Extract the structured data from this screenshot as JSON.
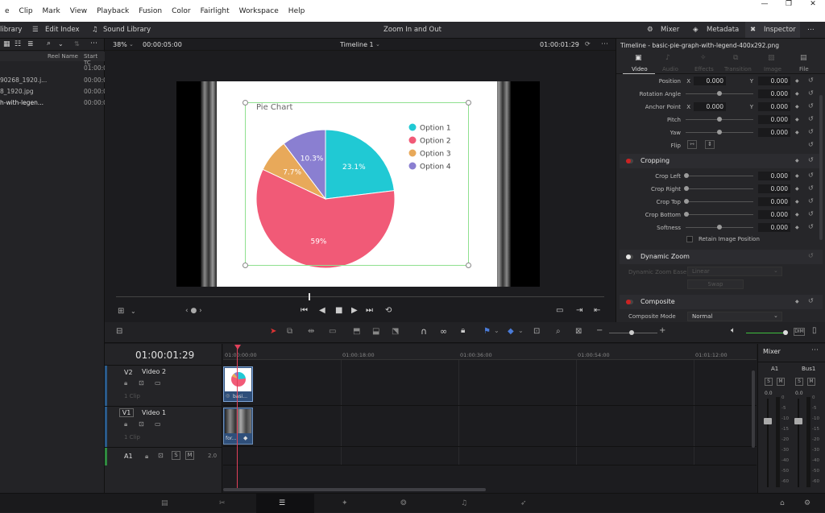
{
  "menu": [
    "e",
    "Clip",
    "Mark",
    "View",
    "Playback",
    "Fusion",
    "Color",
    "Fairlight",
    "Workspace",
    "Help"
  ],
  "toolbar": {
    "library": "library",
    "edit_index": "Edit Index",
    "sound_library": "Sound Library",
    "title": "Zoom In and Out",
    "mixer": "Mixer",
    "metadata": "Metadata",
    "inspector": "Inspector"
  },
  "mediapool": {
    "col_reel": "Reel Name",
    "col_start": "Start TC",
    "rows": [
      {
        "name": "",
        "tc": "01:00:0"
      },
      {
        "name": "90268_1920.j...",
        "tc": "00:00:0"
      },
      {
        "name": "8_1920.jpg",
        "tc": "00:00:0"
      },
      {
        "name": "h-with-legen...",
        "tc": "00:00:0"
      }
    ]
  },
  "viewer": {
    "zoom": "38%",
    "source_tc": "00:00:05:00",
    "timeline_name": "Timeline 1",
    "record_tc": "01:00:01:29"
  },
  "chart_data": {
    "type": "pie",
    "title": "Pie Chart",
    "legend_position": "top-right",
    "series": [
      {
        "name": "Option 1",
        "value": 23.1,
        "label": "23.1%",
        "color": "#20c9d4"
      },
      {
        "name": "Option 2",
        "value": 59,
        "label": "59%",
        "color": "#f15a77"
      },
      {
        "name": "Option 3",
        "value": 7.7,
        "label": "7.7%",
        "color": "#e8a95a"
      },
      {
        "name": "Option 4",
        "value": 10.3,
        "label": "10.3%",
        "color": "#8a7fd1"
      }
    ]
  },
  "inspector": {
    "header": "Timeline - basic-pie-graph-with-legend-400x292.png",
    "tabs": [
      "Video",
      "Audio",
      "Effects",
      "Transition",
      "Image",
      "File"
    ],
    "transform": [
      {
        "label": "Position",
        "x": "0.000",
        "y": "0.000"
      },
      {
        "label": "Rotation Angle",
        "v": "0.000"
      },
      {
        "label": "Anchor Point",
        "x": "0.000",
        "y": "0.000"
      },
      {
        "label": "Pitch",
        "v": "0.000"
      },
      {
        "label": "Yaw",
        "v": "0.000"
      },
      {
        "label": "Flip"
      }
    ],
    "cropping_title": "Cropping",
    "cropping": [
      {
        "label": "Crop Left",
        "v": "0.000"
      },
      {
        "label": "Crop Right",
        "v": "0.000"
      },
      {
        "label": "Crop Top",
        "v": "0.000"
      },
      {
        "label": "Crop Bottom",
        "v": "0.000"
      },
      {
        "label": "Softness",
        "v": "0.000"
      }
    ],
    "retain": "Retain Image Position",
    "dynamic_zoom": "Dynamic Zoom",
    "dz_ease_label": "Dynamic Zoom Ease",
    "dz_ease_value": "Linear",
    "dz_swap": "Swap",
    "composite": "Composite",
    "composite_mode_label": "Composite Mode",
    "composite_mode_value": "Normal"
  },
  "timeline": {
    "timecode": "01:00:01:29",
    "ruler": [
      "01:00:00:00",
      "01:00:18:00",
      "01:00:36:00",
      "01:00:54:00",
      "01:01:12:00"
    ],
    "tracks": [
      {
        "id": "V2",
        "name": "Video 2",
        "clips": "1 Clip",
        "clip_label": "basi..."
      },
      {
        "id": "V1",
        "name": "Video 1",
        "clips": "1 Clip",
        "clip_label": "for..."
      }
    ],
    "audio": {
      "id": "A1",
      "level": "2.0"
    },
    "mixer_title": "Mixer",
    "mixer_ch": [
      "A1",
      "Bus1"
    ],
    "mixer_val": [
      "0.0",
      "0.0"
    ],
    "db_scale": [
      "0",
      "-5",
      "-10",
      "-15",
      "-20",
      "-30",
      "-40",
      "-50",
      "-60"
    ]
  }
}
